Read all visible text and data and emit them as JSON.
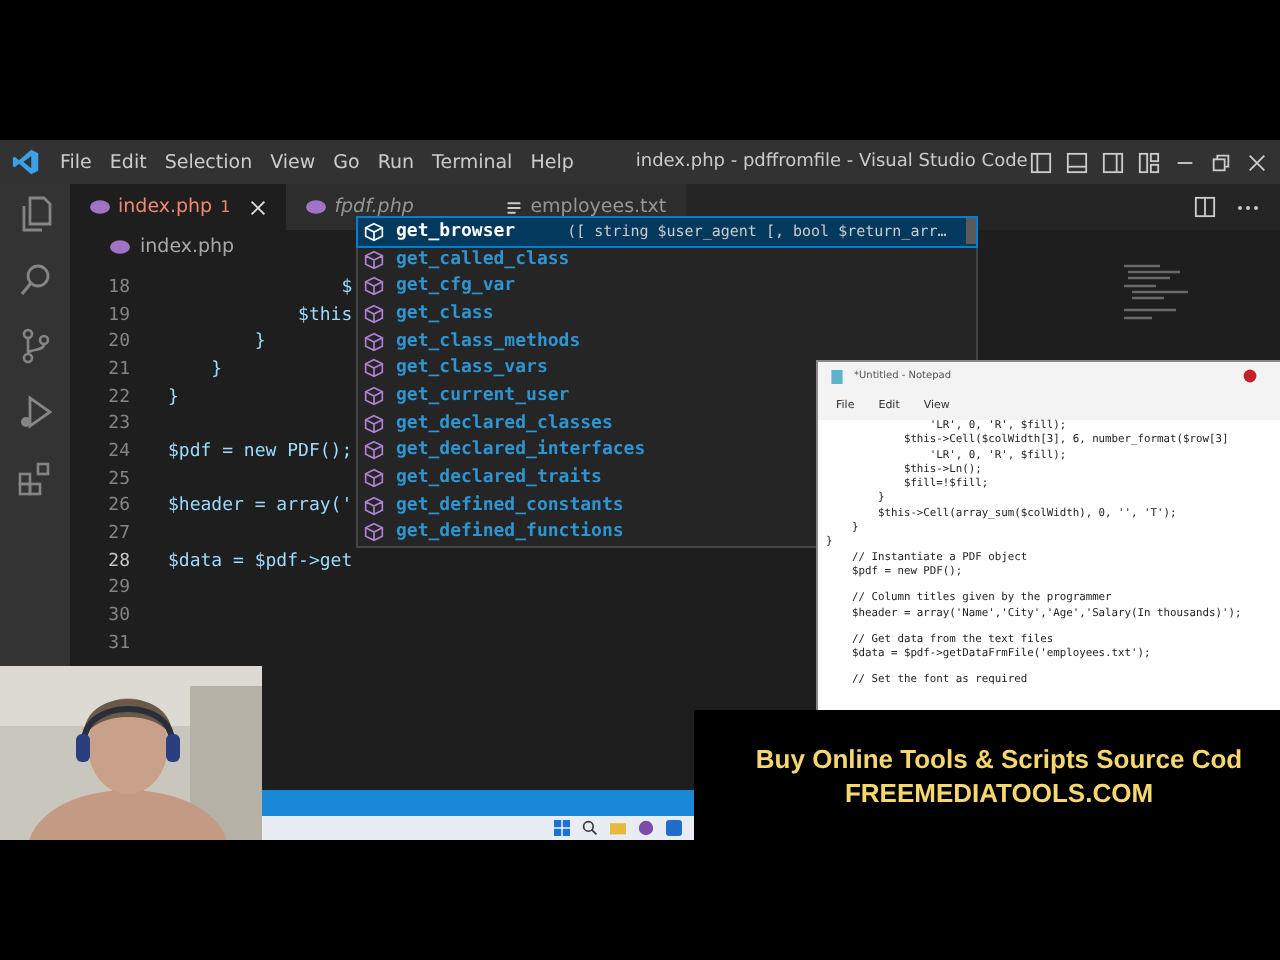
{
  "window": {
    "title": "index.php - pdffromfile - Visual Studio Code"
  },
  "menu": [
    "File",
    "Edit",
    "Selection",
    "View",
    "Go",
    "Run",
    "Terminal",
    "Help"
  ],
  "tabs": [
    {
      "label": "index.php",
      "badge": "1",
      "selected": true,
      "kind": "php",
      "preview": false
    },
    {
      "label": "fpdf.php",
      "selected": false,
      "kind": "php",
      "preview": true
    },
    {
      "label": "employees.txt",
      "selected": false,
      "kind": "text",
      "preview": false
    }
  ],
  "breadcrumb": "index.php",
  "editor": {
    "lines": [
      {
        "number": "18",
        "code": "                $",
        "current": false
      },
      {
        "number": "19",
        "code": "            $this",
        "current": false
      },
      {
        "number": "20",
        "code": "        }",
        "current": false
      },
      {
        "number": "21",
        "code": "    }",
        "current": false
      },
      {
        "number": "22",
        "code": "}",
        "current": false
      },
      {
        "number": "23",
        "current": false
      },
      {
        "number": "24",
        "code": "$pdf = new PDF();",
        "current": false
      },
      {
        "number": "25",
        "current": false
      },
      {
        "number": "26",
        "code": "$header = array('",
        "current": false
      },
      {
        "number": "27",
        "current": false
      },
      {
        "number": "28",
        "code": "$data = $pdf->get",
        "current": true
      },
      {
        "number": "29",
        "current": false
      },
      {
        "number": "30",
        "current": false
      },
      {
        "number": "31",
        "current": false
      }
    ]
  },
  "suggestions": {
    "items": [
      {
        "label": "get_browser",
        "selected": true,
        "detail": "([ string $user_agent [, bool $return_arr…"
      },
      {
        "label": "get_called_class",
        "selected": false
      },
      {
        "label": "get_cfg_var",
        "selected": false
      },
      {
        "label": "get_class",
        "selected": false
      },
      {
        "label": "get_class_methods",
        "selected": false
      },
      {
        "label": "get_class_vars",
        "selected": false
      },
      {
        "label": "get_current_user",
        "selected": false
      },
      {
        "label": "get_declared_classes",
        "selected": false
      },
      {
        "label": "get_declared_interfaces",
        "selected": false
      },
      {
        "label": "get_declared_traits",
        "selected": false
      },
      {
        "label": "get_defined_constants",
        "selected": false
      },
      {
        "label": "get_defined_functions",
        "selected": false
      }
    ]
  },
  "notepad": {
    "title": "*Untitled - Notepad",
    "menu": [
      "File",
      "Edit",
      "View"
    ],
    "paragraphs": [
      [
        "                'LR', 0, 'R', $fill);",
        "            $this->Cell($colWidth[3], 6, number_format($row[3]",
        "                'LR', 0, 'R', $fill);",
        "            $this->Ln();",
        "            $fill=!$fill;",
        "        }",
        "        $this->Cell(array_sum($colWidth), 0, '', 'T');",
        "    }",
        "}",
        "    // Instantiate a PDF object",
        "    $pdf = new PDF();"
      ],
      [
        "    // Column titles given by the programmer",
        "    $header = array('Name','City','Age','Salary(In thousands)');"
      ],
      [
        "    // Get data from the text files",
        "    $data = $pdf->getDataFrmFile('employees.txt');"
      ],
      [
        "    // Set the font as required"
      ]
    ]
  },
  "banner": {
    "lines": [
      "Buy Online Tools & Scripts Source Cod",
      "FREEMEDIATOOLS.COM"
    ]
  }
}
